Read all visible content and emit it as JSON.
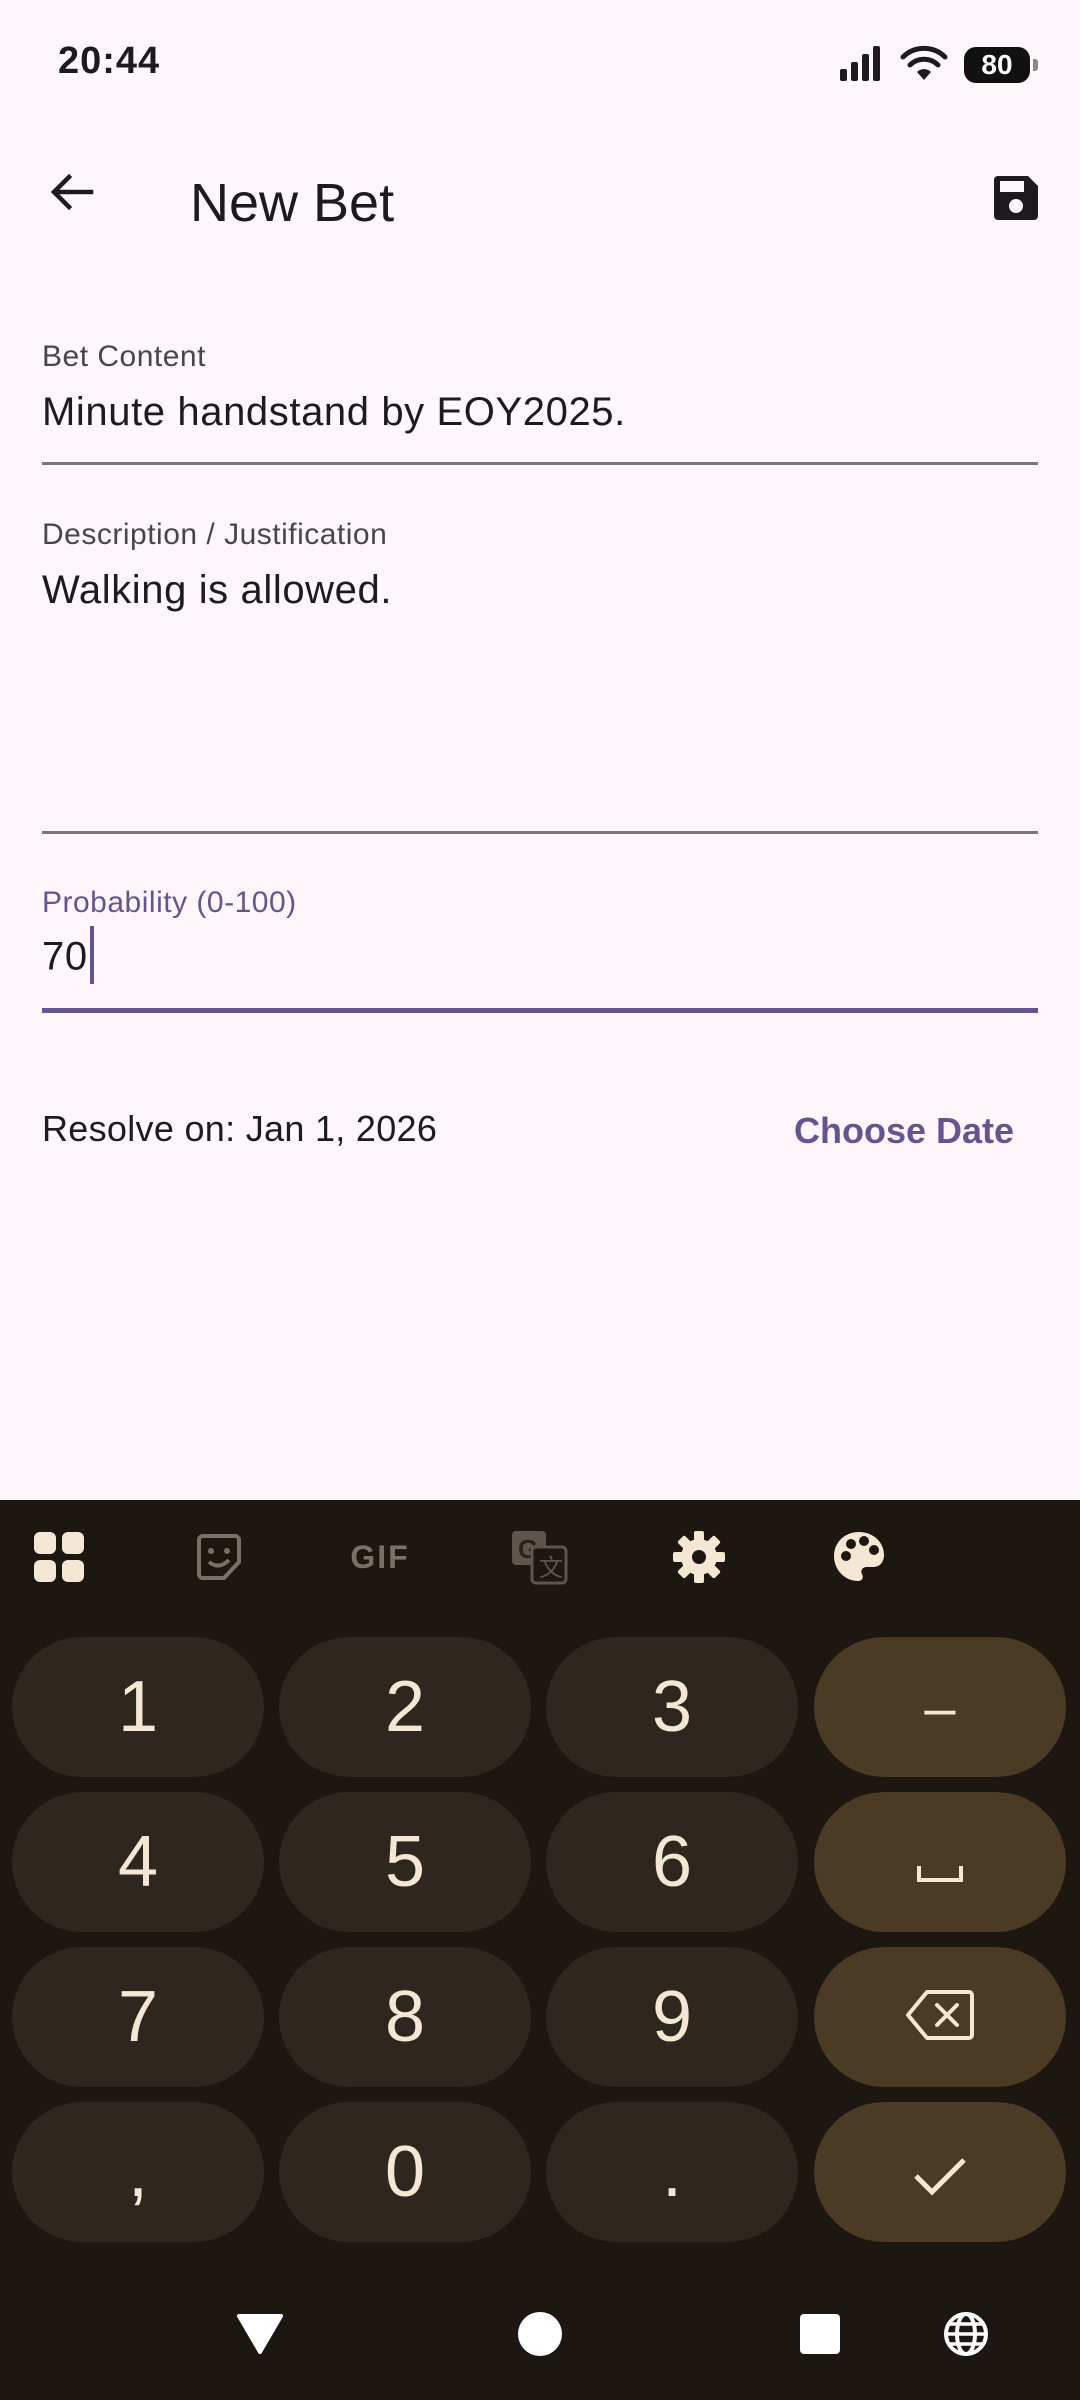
{
  "status_bar": {
    "time": "20:44",
    "battery": "80"
  },
  "app_bar": {
    "title": "New Bet"
  },
  "form": {
    "bet_content": {
      "label": "Bet Content",
      "value": "Minute handstand by EOY2025."
    },
    "description": {
      "label": "Description / Justification",
      "value": "Walking is allowed."
    },
    "probability": {
      "label": "Probability (0-100)",
      "value": "70"
    },
    "resolve_text": "Resolve on: Jan 1, 2026",
    "choose_date_label": "Choose Date"
  },
  "keyboard": {
    "toolbar_icons": [
      "apps-icon",
      "sticker-icon",
      "gif-icon",
      "translate-icon",
      "gear-icon",
      "palette-icon"
    ],
    "gif_label": "GIF",
    "keys": {
      "k1": "1",
      "k2": "2",
      "k3": "3",
      "minus": "–",
      "k4": "4",
      "k5": "5",
      "k6": "6",
      "space": "␣",
      "k7": "7",
      "k8": "8",
      "k9": "9",
      "comma": ",",
      "k0": "0",
      "period": "."
    }
  },
  "colors": {
    "accent": "#65558f",
    "background": "#fdf7fc",
    "keyboard_bg": "#1d1712",
    "key_bg": "#2e271f",
    "key_special_bg": "#4b3a24"
  }
}
